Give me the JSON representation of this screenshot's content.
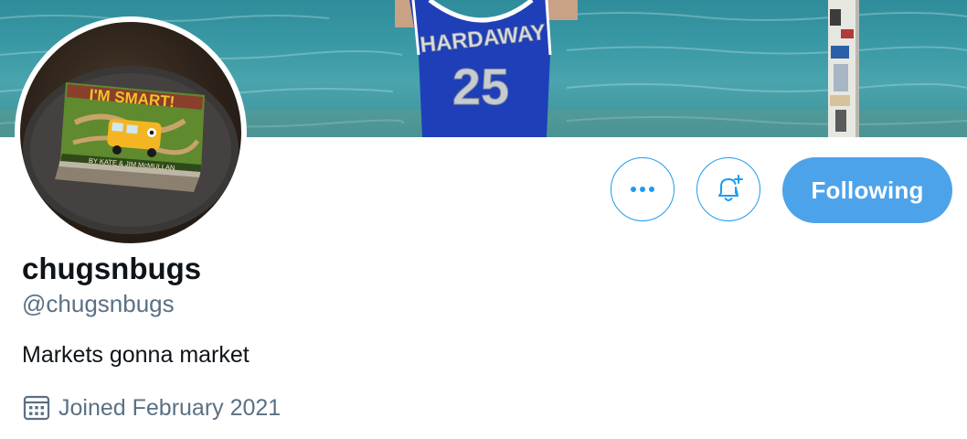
{
  "profile": {
    "display_name": "chugsnbugs",
    "handle": "@chugsnbugs",
    "bio": "Markets gonna market",
    "joined": "Joined February 2021"
  },
  "actions": {
    "more_icon": "more-horizontal-icon",
    "notify_icon": "bell-plus-icon",
    "following_label": "Following"
  },
  "banner": {
    "jersey_name": "HARDAWAY",
    "jersey_number": "25"
  },
  "avatar": {
    "book_title": "I'M SMART!",
    "book_author": "BY KATE & JIM McMULLAN"
  },
  "colors": {
    "accent": "#1d9bf0",
    "following_bg": "#4da3ea",
    "text_primary": "#0f1419",
    "text_secondary": "#5b7083"
  }
}
